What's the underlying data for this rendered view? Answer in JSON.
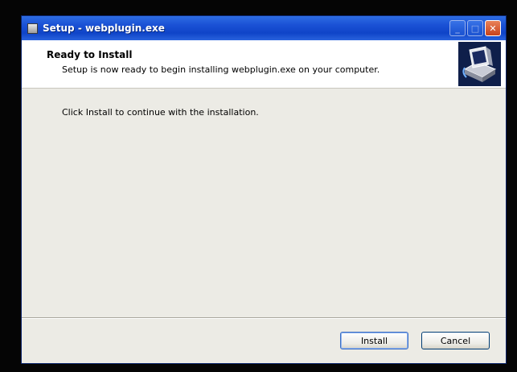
{
  "window": {
    "title": "Setup - webplugin.exe"
  },
  "header": {
    "title": "Ready to Install",
    "subtitle": "Setup is now ready to begin installing webplugin.exe on your computer."
  },
  "body": {
    "instruction": "Click Install to continue with the installation."
  },
  "buttons": {
    "install": "Install",
    "cancel": "Cancel"
  },
  "titlebar_buttons": {
    "minimize": "_",
    "maximize": "□",
    "close": "✕"
  },
  "colors": {
    "titlebar": "#1b52d6",
    "window_bg": "#ecebe5",
    "header_bg": "#ffffff",
    "close_button": "#c8421c"
  },
  "icons": {
    "window": "setup-app-icon",
    "header": "computer-install-icon"
  }
}
